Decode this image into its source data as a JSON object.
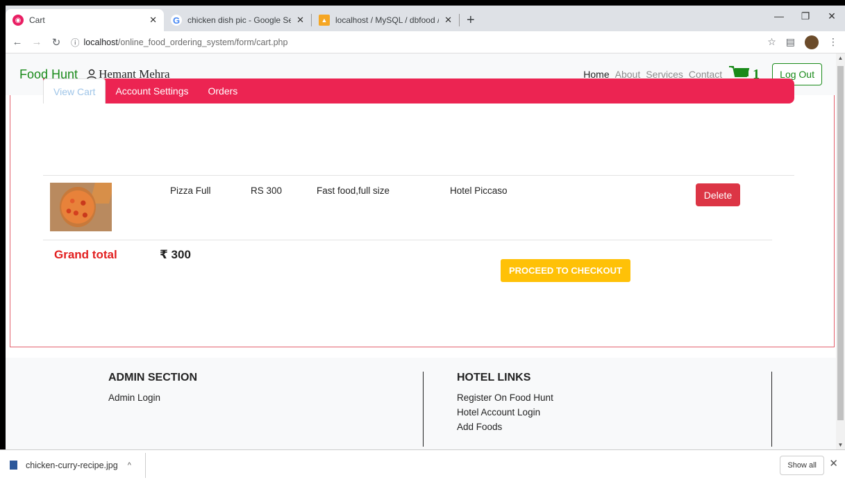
{
  "browser": {
    "tabs": [
      {
        "title": "Cart",
        "favicon": "cart-favicon",
        "active": true
      },
      {
        "title": "chicken dish pic - Google Search",
        "favicon": "google-icon",
        "active": false
      },
      {
        "title": "localhost / MySQL / dbfood / tba",
        "favicon": "phpmyadmin-icon",
        "active": false
      }
    ],
    "url_host": "localhost",
    "url_path": "/online_food_ordering_system/form/cart.php"
  },
  "navbar": {
    "brand": "Food Hunt",
    "user_name": "Hemant Mehra",
    "links": [
      "Home",
      "About",
      "Services",
      "Contact"
    ],
    "cart_count": "1",
    "logout_label": "Log Out"
  },
  "tabs": {
    "view_cart": "View Cart",
    "account_settings": "Account Settings",
    "orders": "Orders"
  },
  "cart": {
    "items": [
      {
        "name": "Pizza Full",
        "price": "RS 300",
        "description": "Fast food,full size",
        "hotel": "Hotel Piccaso",
        "delete_label": "Delete"
      }
    ],
    "grand_total_label": "Grand total",
    "grand_total_value": "₹ 300",
    "checkout_label": "PROCEED TO CHECKOUT"
  },
  "footer": {
    "admin_heading": "ADMIN SECTION",
    "admin_links": [
      "Admin Login"
    ],
    "hotel_heading": "HOTEL LINKS",
    "hotel_links": [
      "Register On Food Hunt",
      "Hotel Account Login",
      "Add Foods"
    ]
  },
  "downloads": {
    "file_name": "chicken-curry-recipe.jpg",
    "show_all_label": "Show all"
  },
  "colors": {
    "brand_green": "#198a19",
    "tab_bar": "#ec2452",
    "delete_red": "#dc3545",
    "checkout_yellow": "#ffc107",
    "grand_total_red": "#e21f1f"
  }
}
